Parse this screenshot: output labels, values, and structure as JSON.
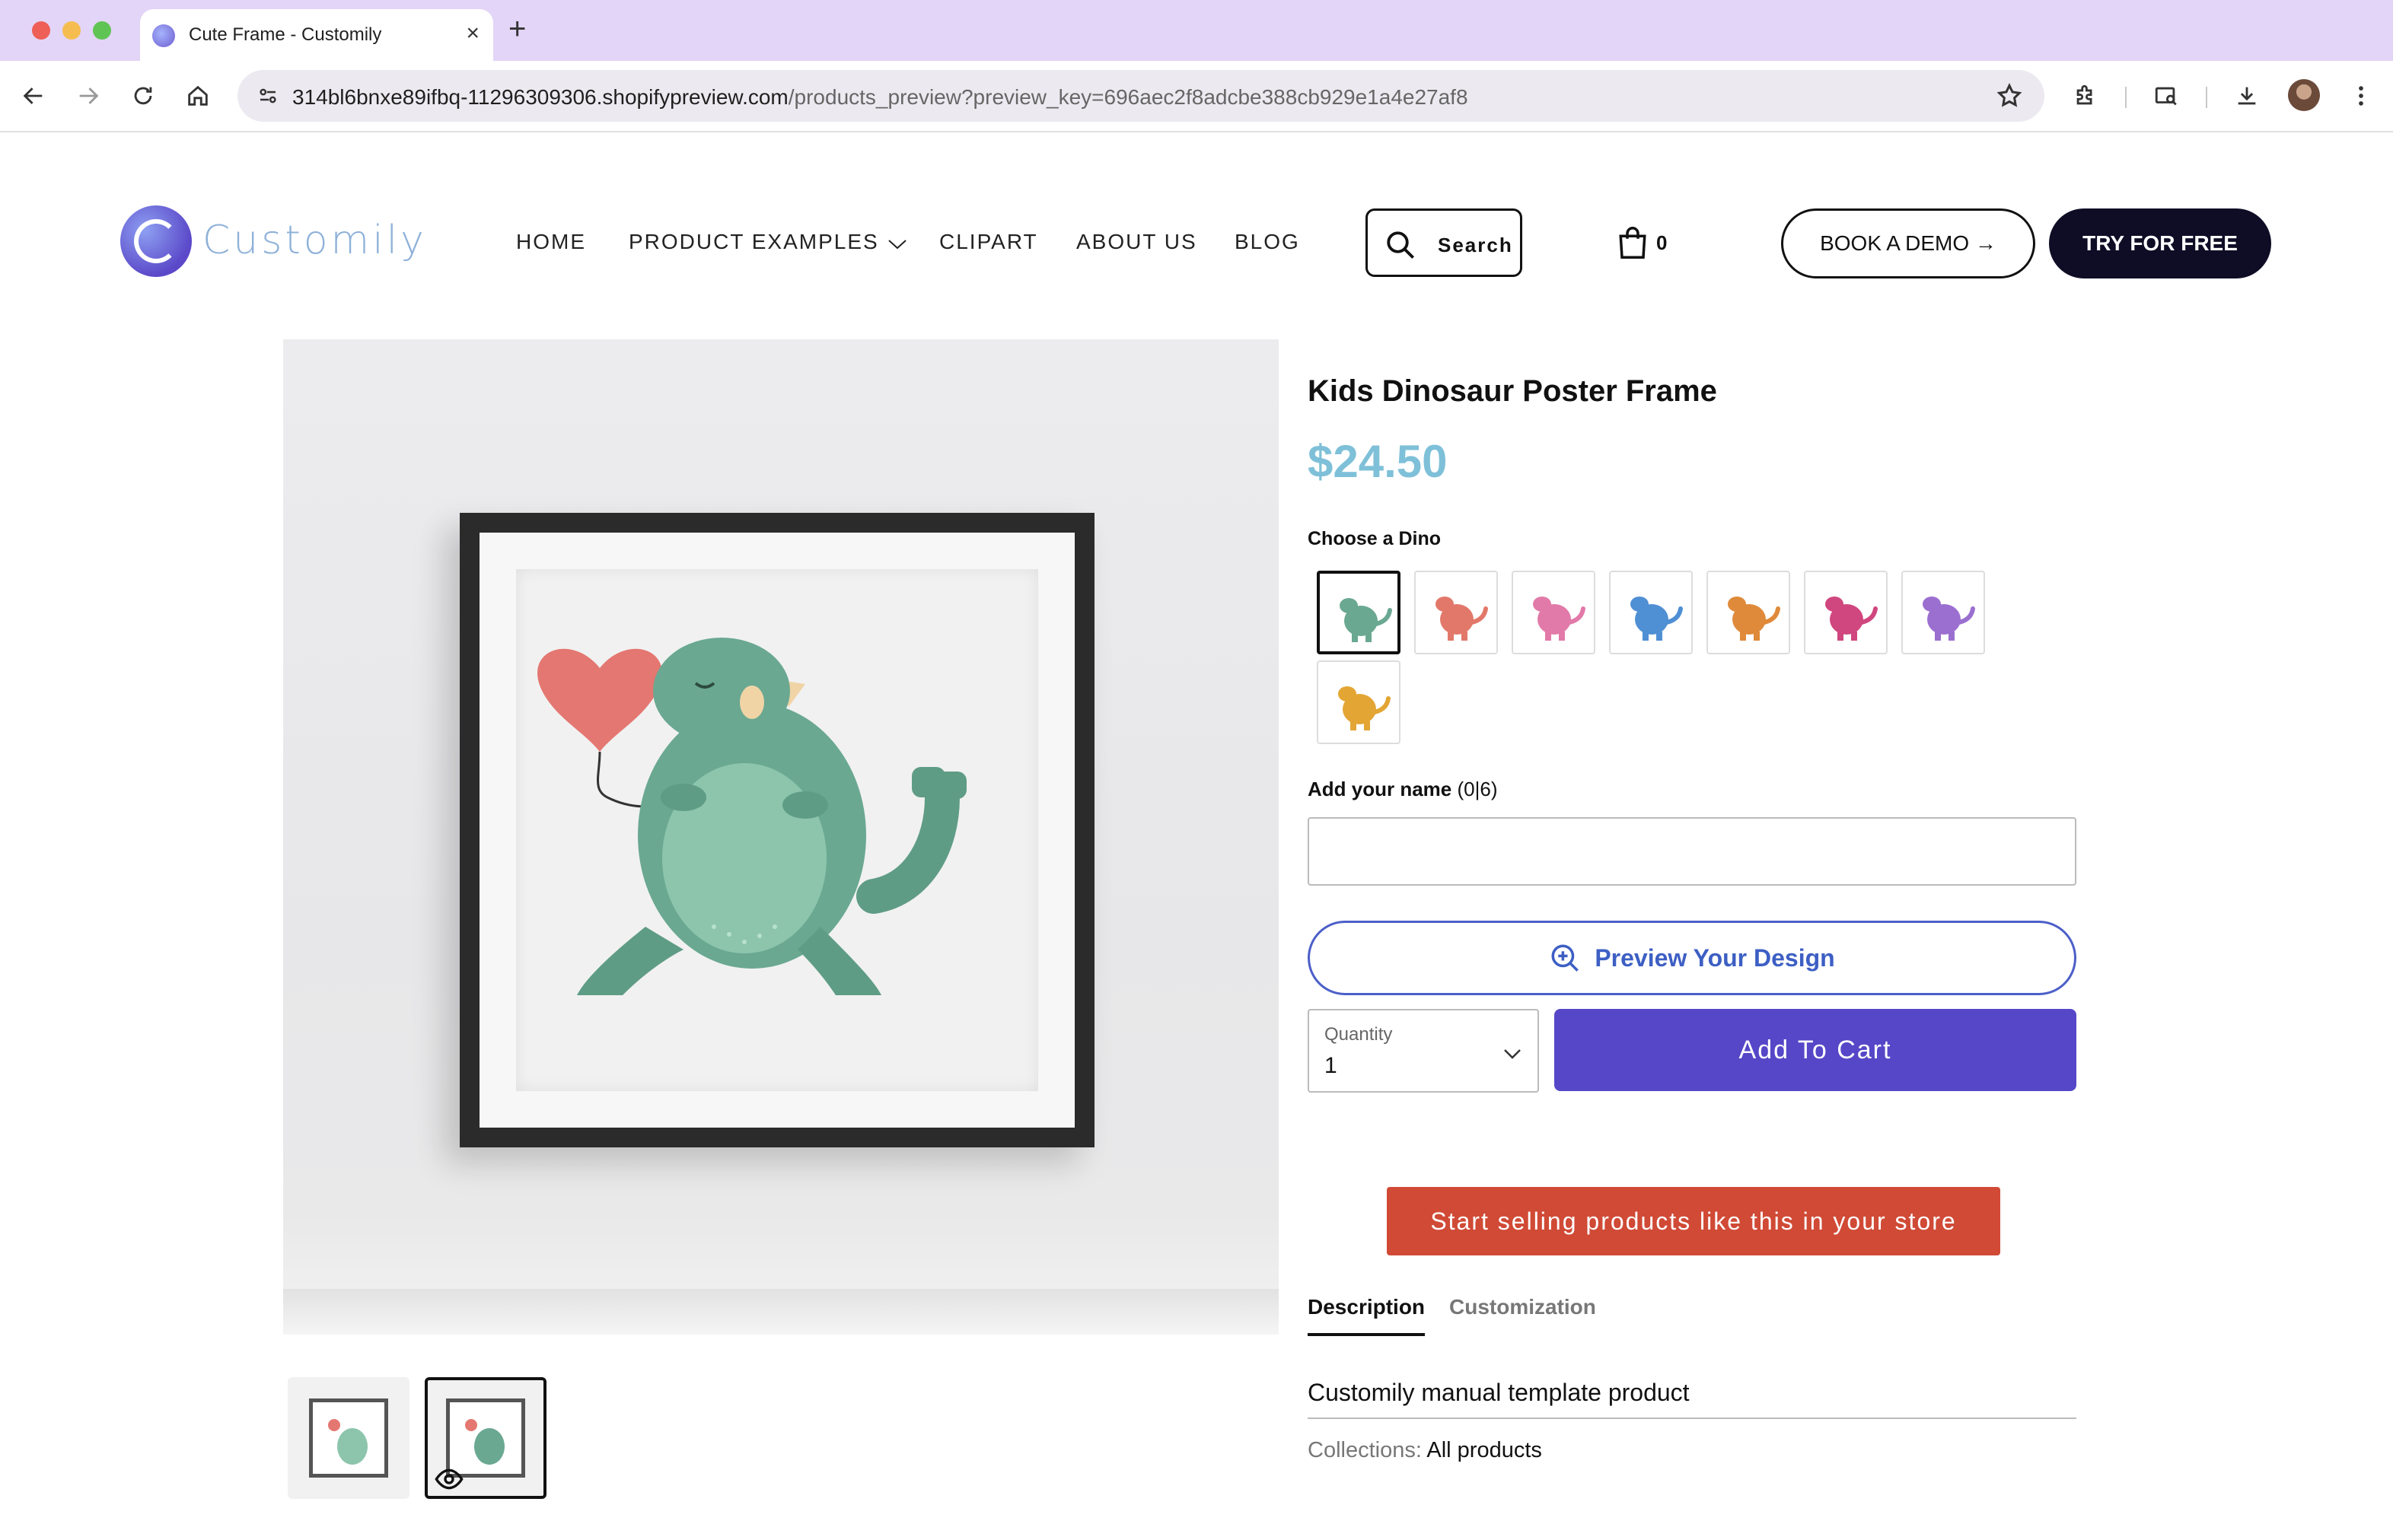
{
  "browser": {
    "tab_title": "Cute Frame - Customily",
    "url_host": "314bl6bnxe89ifbq-11296309306.shopifypreview.com",
    "url_path": "/products_preview?preview_key=696aec2f8adcbe388cb929e1a4e27af8"
  },
  "site": {
    "brand": "Customily",
    "nav": {
      "home": "HOME",
      "product_examples": "PRODUCT EXAMPLES",
      "clipart": "CLIPART",
      "about": "ABOUT US",
      "blog": "BLOG"
    },
    "search_label": "Search",
    "cart_count": "0",
    "book_demo": "BOOK A DEMO →",
    "try_free": "TRY FOR FREE"
  },
  "product": {
    "title": "Kids Dinosaur Poster Frame",
    "price": "$24.50",
    "choose_label": "Choose a Dino",
    "dino_options": [
      {
        "name": "green-dino-heart",
        "color": "#6aa892",
        "selected": true
      },
      {
        "name": "coral-dino",
        "color": "#e2786a",
        "selected": false
      },
      {
        "name": "pink-triceratops",
        "color": "#e27aa9",
        "selected": false
      },
      {
        "name": "blue-pterodactyl",
        "color": "#4f8fd4",
        "selected": false
      },
      {
        "name": "orange-brontosaurus",
        "color": "#df8a3a",
        "selected": false
      },
      {
        "name": "magenta-dino",
        "color": "#d0467e",
        "selected": false
      },
      {
        "name": "purple-dino",
        "color": "#9b6fd0",
        "selected": false
      },
      {
        "name": "yellow-stegosaurus",
        "color": "#e3a534",
        "selected": false
      }
    ],
    "name_label": "Add your name",
    "name_counter": "(0|6)",
    "name_value": "",
    "preview_label": "Preview Your Design",
    "quantity_label": "Quantity",
    "quantity_value": "1",
    "add_to_cart": "Add To Cart",
    "sell_banner": "Start selling products like this in your store",
    "tabs": {
      "description": "Description",
      "customization": "Customization"
    },
    "description_text": "Customily manual template product",
    "collections_label": "Collections:",
    "collections_value": "All products"
  },
  "colors": {
    "accent_purple": "#5547c7",
    "price_blue": "#7fc0d9",
    "banner_red": "#d04a36",
    "dark_button": "#0f0c26"
  }
}
